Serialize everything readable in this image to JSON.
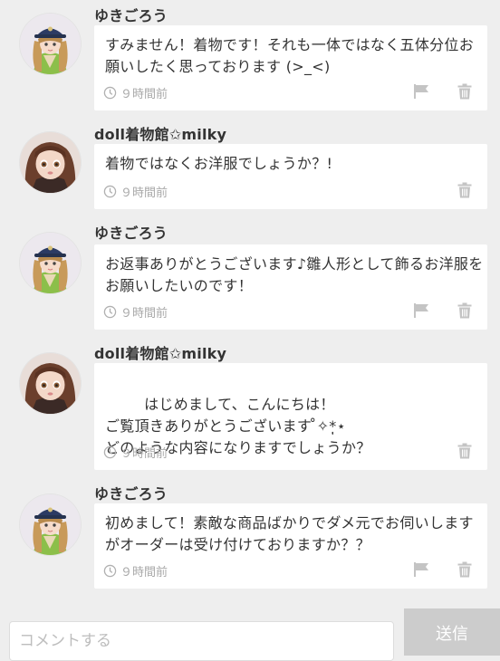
{
  "comments": [
    {
      "user": "ゆきごろう",
      "avatar": "doll-avatar-cap",
      "message": "すみません！着物です！それも一体ではなく五体分位お願いしたく思っております (>_<)",
      "time": "９時間前",
      "flag": true
    },
    {
      "user": "doll着物館✩milky",
      "avatar": "doll-avatar-brown",
      "message": "着物ではなくお洋服でしょうか？!",
      "time": "９時間前",
      "flag": false
    },
    {
      "user": "ゆきごろう",
      "avatar": "doll-avatar-cap",
      "message": "お返事ありがとうございます♪雛人形として飾るお洋服をお願いしたいのです！",
      "time": "９時間前",
      "flag": true
    },
    {
      "user": "doll着物館✩milky",
      "avatar": "doll-avatar-brown",
      "message": "はじめまして、こんにちは！\nご覧頂きありがとうございます ̊✧*̣̩⋆",
      "message_line3": "どのような内容になりますでしょうか？",
      "time": "９時間前",
      "flag": false
    },
    {
      "user": "ゆきごろう",
      "avatar": "doll-avatar-cap",
      "message": "初めまして！素敵な商品ばかりでダメ元でお伺いしますがオーダーは受け付けておりますか？？",
      "time": "９時間前",
      "flag": true
    }
  ],
  "icons": {
    "time": "clock-icon",
    "flag": "flag-icon",
    "delete": "trash-icon"
  },
  "input": {
    "placeholder": "コメントする",
    "send_label": "送信"
  },
  "colors": {
    "background": "#eeeeee",
    "bubble": "#ffffff",
    "text": "#333333",
    "muted": "#a8a8a8",
    "send_button": "#cccccc"
  }
}
